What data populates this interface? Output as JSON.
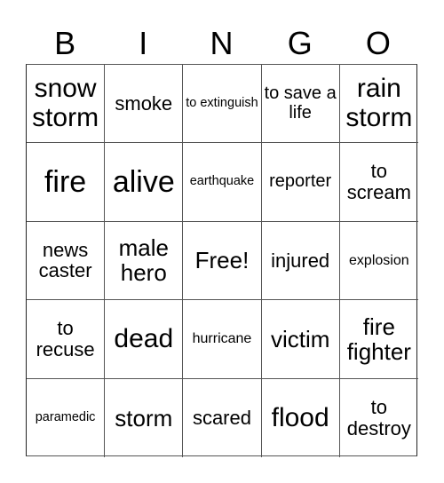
{
  "header": {
    "letters": [
      "B",
      "I",
      "N",
      "G",
      "O"
    ]
  },
  "cells": [
    {
      "text": "snow storm",
      "size": "s-xl"
    },
    {
      "text": "smoke",
      "size": "s-m"
    },
    {
      "text": "to extinguish",
      "size": "s-xs"
    },
    {
      "text": "to save a life",
      "size": "s-ms"
    },
    {
      "text": "rain storm",
      "size": "s-xl"
    },
    {
      "text": "fire",
      "size": "s-xxl"
    },
    {
      "text": "alive",
      "size": "s-xxl"
    },
    {
      "text": "earthquake",
      "size": "s-xs"
    },
    {
      "text": "reporter",
      "size": "s-ms"
    },
    {
      "text": "to scream",
      "size": "s-m"
    },
    {
      "text": "news caster",
      "size": "s-m"
    },
    {
      "text": "male hero",
      "size": "s-l"
    },
    {
      "text": "Free!",
      "size": "s-l"
    },
    {
      "text": "injured",
      "size": "s-m"
    },
    {
      "text": "explosion",
      "size": "s-s"
    },
    {
      "text": "to recuse",
      "size": "s-m"
    },
    {
      "text": "dead",
      "size": "s-xl"
    },
    {
      "text": "hurricane",
      "size": "s-s"
    },
    {
      "text": "victim",
      "size": "s-l"
    },
    {
      "text": "fire fighter",
      "size": "s-l"
    },
    {
      "text": "paramedic",
      "size": "s-xs"
    },
    {
      "text": "storm",
      "size": "s-l"
    },
    {
      "text": "scared",
      "size": "s-m"
    },
    {
      "text": "flood",
      "size": "s-xl"
    },
    {
      "text": "to destroy",
      "size": "s-m"
    }
  ]
}
